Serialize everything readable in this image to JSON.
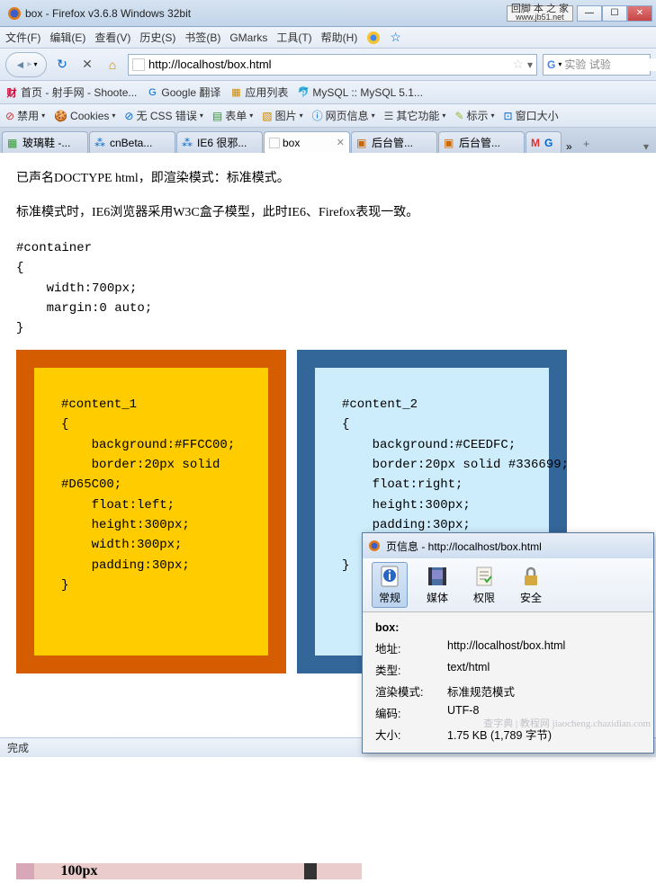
{
  "titlebar": {
    "title": "box - Firefox v3.6.8 Windows 32bit",
    "ad_top": "回脚 本 之 家",
    "ad_bottom": "www.jb51.net"
  },
  "menubar": {
    "items": [
      "文件(F)",
      "编辑(E)",
      "查看(V)",
      "历史(S)",
      "书签(B)",
      "GMarks",
      "工具(T)",
      "帮助(H)"
    ]
  },
  "navbar": {
    "url": "http://localhost/box.html",
    "search_placeholder": "实验 试验"
  },
  "bookmarks": {
    "items": [
      {
        "icon": "财",
        "icon_color": "#c03",
        "label": "首页 - 射手网 - Shoote..."
      },
      {
        "icon": "G",
        "icon_color": "#06c",
        "label": "Google 翻译"
      },
      {
        "icon": "▦",
        "icon_color": "#c80",
        "label": "应用列表"
      },
      {
        "icon": "🐬",
        "icon_color": "#08a",
        "label": "MySQL :: MySQL 5.1..."
      }
    ]
  },
  "devbar": {
    "items": [
      {
        "icon": "⊘",
        "color": "#c33",
        "label": "禁用"
      },
      {
        "icon": "🍪",
        "color": "#964",
        "label": "Cookies"
      },
      {
        "icon": "⊘",
        "color": "#06c",
        "label": "无 CSS 错误"
      },
      {
        "icon": "▤",
        "color": "#393",
        "label": "表单"
      },
      {
        "icon": "▧",
        "color": "#c80",
        "label": "图片"
      },
      {
        "icon": "ⓘ",
        "color": "#06c",
        "label": "网页信息"
      },
      {
        "icon": "☰",
        "color": "#555",
        "label": "其它功能"
      },
      {
        "icon": "✎",
        "color": "#9b3",
        "label": "标示"
      },
      {
        "icon": "⊡",
        "color": "#06c",
        "label": "窗口大小"
      }
    ]
  },
  "tabs": {
    "items": [
      {
        "icon": "▦",
        "icon_color": "#393",
        "label": "玻璃鞋 -...",
        "active": false
      },
      {
        "icon": "⁂",
        "icon_color": "#06c",
        "label": "cnBeta...",
        "active": false
      },
      {
        "icon": "⁂",
        "icon_color": "#06c",
        "label": "IE6 很邪...",
        "active": false
      },
      {
        "icon": "▫",
        "icon_color": "#999",
        "label": "box",
        "active": true
      },
      {
        "icon": "▣",
        "icon_color": "#c60",
        "label": "后台管...",
        "active": false
      },
      {
        "icon": "▣",
        "icon_color": "#c60",
        "label": "后台管...",
        "active": false
      }
    ],
    "gmail_label": "G",
    "overflow": "»"
  },
  "content": {
    "p1": "已声名DOCTYPE html，即渲染模式：标准模式。",
    "p2": "标准模式时，IE6浏览器采用W3C盒子模型，此时IE6、Firefox表现一致。",
    "container_css": "#container\n{\n    width:700px;\n    margin:0 auto;\n}",
    "box1_css": "#content_1\n{\n    background:#FFCC00;\n    border:20px solid\n#D65C00;\n    float:left;\n    height:300px;\n    width:300px;\n    padding:30px;\n}",
    "box2_css": "#content_2\n{\n    background:#CEEDFC;\n    border:20px solid #336699;\n    float:right;\n    height:300px;\n    padding:30px;\n    width:300px;\n}",
    "ruler_label": "100px"
  },
  "statusbar": {
    "text": "完成"
  },
  "pageinfo": {
    "title": "页信息 - http://localhost/box.html",
    "tools": [
      {
        "label": "常规",
        "active": true
      },
      {
        "label": "媒体",
        "active": false
      },
      {
        "label": "权限",
        "active": false
      },
      {
        "label": "安全",
        "active": false
      }
    ],
    "heading": "box:",
    "rows": [
      {
        "k": "地址:",
        "v": "http://localhost/box.html"
      },
      {
        "k": "类型:",
        "v": "text/html"
      },
      {
        "k": "渲染模式:",
        "v": "标准规范模式"
      },
      {
        "k": "编码:",
        "v": "UTF-8"
      },
      {
        "k": "大小:",
        "v": "1.75 KB (1,789 字节)"
      }
    ]
  },
  "watermark": "查字典 | 教程网\njiaocheng.chazidian.com"
}
